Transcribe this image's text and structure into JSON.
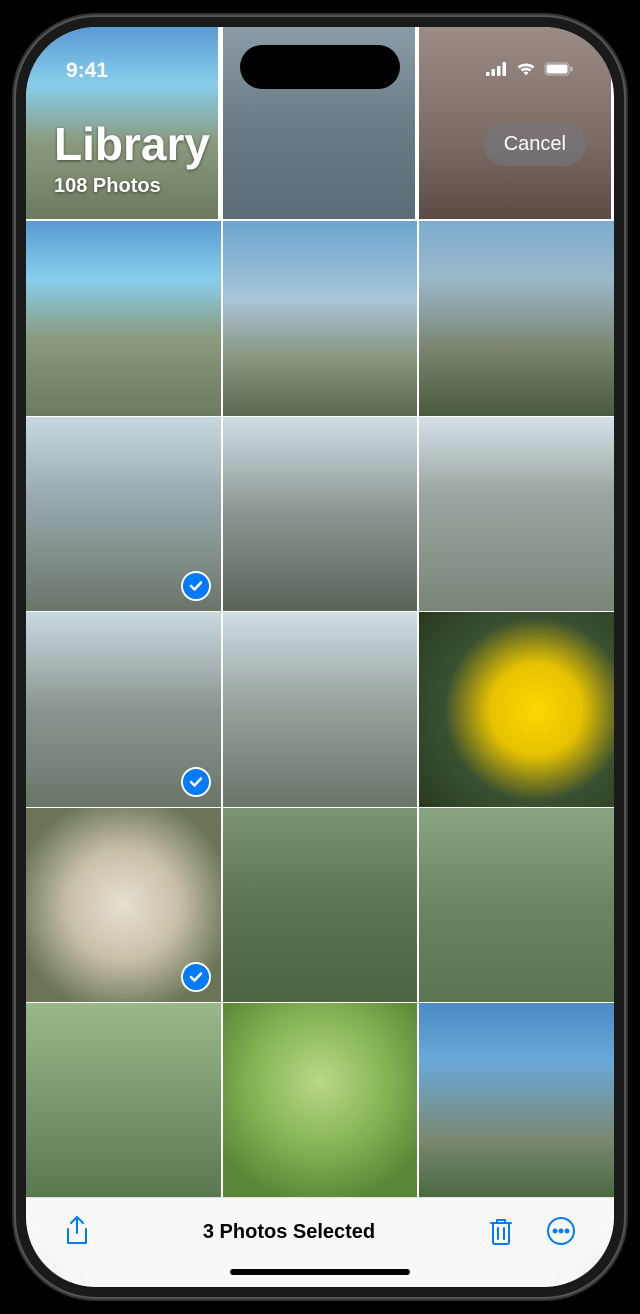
{
  "status": {
    "time": "9:41"
  },
  "header": {
    "title": "Library",
    "count": "108 Photos",
    "cancel_label": "Cancel"
  },
  "grid": {
    "photos": [
      {
        "selected": false,
        "style": "mountain-1"
      },
      {
        "selected": false,
        "style": "market"
      },
      {
        "selected": false,
        "style": "pottery"
      },
      {
        "selected": false,
        "style": "mountain-1"
      },
      {
        "selected": false,
        "style": "mountain-2"
      },
      {
        "selected": false,
        "style": "mountain-3"
      },
      {
        "selected": true,
        "style": "mountain-4"
      },
      {
        "selected": false,
        "style": "mountain-5"
      },
      {
        "selected": false,
        "style": "mountain-6"
      },
      {
        "selected": true,
        "style": "mountain-7"
      },
      {
        "selected": false,
        "style": "mountain-8"
      },
      {
        "selected": false,
        "style": "flower-yellow"
      },
      {
        "selected": true,
        "style": "flower-white"
      },
      {
        "selected": false,
        "style": "people-1"
      },
      {
        "selected": false,
        "style": "people-2"
      },
      {
        "selected": false,
        "style": "people-3"
      },
      {
        "selected": false,
        "style": "leaf-green"
      },
      {
        "selected": false,
        "style": "mountain-9"
      }
    ]
  },
  "toolbar": {
    "selected_label": "3 Photos Selected"
  },
  "colors": {
    "accent": "#007AFF"
  }
}
